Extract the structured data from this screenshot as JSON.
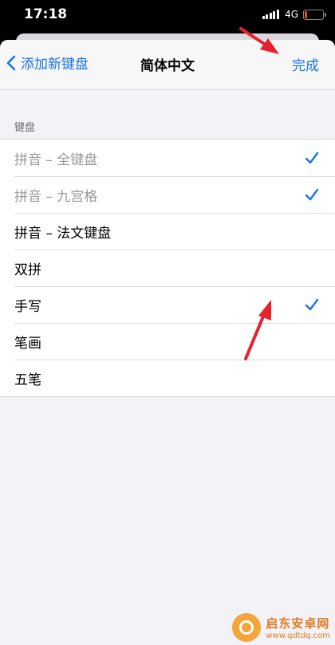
{
  "status_bar": {
    "time": "17:18",
    "network": "4G",
    "signal_icon": "signal-bars-icon",
    "battery_icon": "battery-low-icon"
  },
  "nav": {
    "back_label": "添加新键盘",
    "back_icon": "chevron-left-icon",
    "title": "简体中文",
    "done_label": "完成"
  },
  "section": {
    "header": "键盘"
  },
  "keyboards": [
    {
      "label": "拼音 – 全键盘",
      "checked": true,
      "disabled": true
    },
    {
      "label": "拼音 – 九宫格",
      "checked": true,
      "disabled": true
    },
    {
      "label": "拼音 – 法文键盘",
      "checked": false,
      "disabled": false
    },
    {
      "label": "双拼",
      "checked": false,
      "disabled": false
    },
    {
      "label": "手写",
      "checked": true,
      "disabled": false
    },
    {
      "label": "笔画",
      "checked": false,
      "disabled": false
    },
    {
      "label": "五笔",
      "checked": false,
      "disabled": false
    }
  ],
  "colors": {
    "accent": "#1a73e8",
    "annotation_arrow": "#e8222b",
    "disabled_text": "#9a9a9a"
  },
  "watermark": {
    "title": "启东安卓网",
    "url": "www.qdtdq.com"
  }
}
